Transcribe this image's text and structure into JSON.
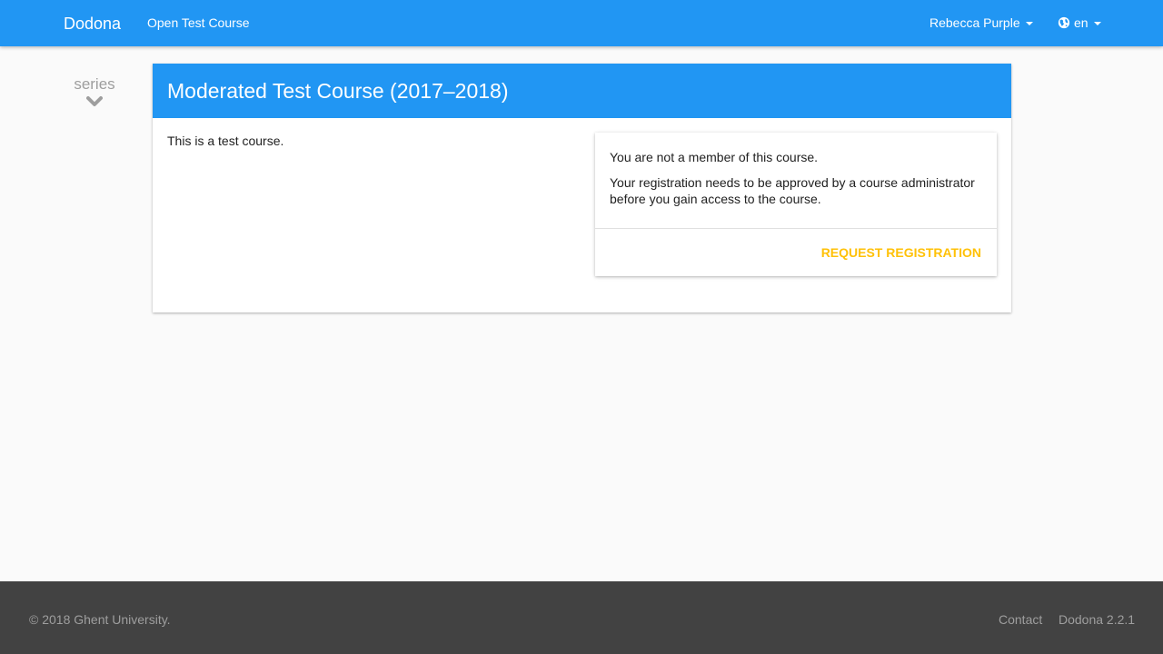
{
  "navbar": {
    "brand": "Dodona",
    "course_link": "Open Test Course",
    "user_name": "Rebecca Purple",
    "language": "en",
    "icons": {
      "language": "globe-icon",
      "dropdown": "caret-down-icon"
    },
    "color": "#2196f3"
  },
  "sidebar": {
    "series_label": "series",
    "icon": "chevron-down-icon"
  },
  "course": {
    "title": "Moderated Test Course (2017–2018)",
    "description": "This is a test course."
  },
  "registration": {
    "not_member": "You are not a member of this course.",
    "approval_notice": "Your registration needs to be approved by a course administrator before you gain access to the course.",
    "request_button": "REQUEST REGISTRATION",
    "accent_color": "#ffc107"
  },
  "footer": {
    "copyright": "© 2018 Ghent University.",
    "contact": "Contact",
    "version": "Dodona 2.2.1",
    "color": "#424242"
  }
}
